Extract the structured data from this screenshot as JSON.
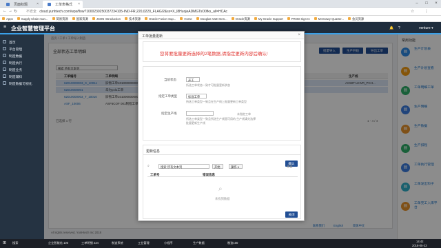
{
  "browser": {
    "tabs": [
      {
        "label": "页面标题"
      },
      {
        "label": "工单表格式"
      }
    ],
    "address": "cloud.yunhtech.com/wps/flow?1000230250037234105-IND-FR,220,0220_FLAG/2&ss=X_l8HuojeADMGTsO0fks_all=HCAc",
    "insecure_label": "不安全",
    "bookmarks": [
      "Apps",
      "Supply Chain man...",
      "简易资源",
      "国家资源",
      "JSON Introduction",
      "技术资源",
      "Oracle Fusion Sup...",
      "Home",
      "Douglas VaEt Gen...",
      "Oracle资源",
      "My Oracle Support",
      "PROD Sign In",
      "McGrawy Quarter...",
      "会员资源"
    ]
  },
  "app": {
    "title": "企业智慧管理平台",
    "user": "venture ▾"
  },
  "sidebar": {
    "items": [
      {
        "label": "首页"
      },
      {
        "label": "平台管理"
      },
      {
        "label": "制造数据"
      },
      {
        "label": "制造执行"
      },
      {
        "label": "制造业务"
      },
      {
        "label": "制造辅料"
      },
      {
        "label": "制造数据可视化"
      }
    ]
  },
  "main": {
    "breadcrumb": "首页 / 工单 / 工单导入制造",
    "page_title": "全部状态工单明细",
    "search_placeholder": "搜索 所有文本列",
    "buttons": [
      "批量导入",
      "生产开始",
      "导出工单"
    ],
    "table": {
      "headers": [
        "",
        "工单编号",
        "工单明细",
        "生产线"
      ],
      "rows": [
        {
          "id": "62010000003_C_10011",
          "desc": "旧物工单1010000000000"
        },
        {
          "id": "62010000001",
          "desc": "华为yolo工单"
        },
        {
          "id": "62010000003_T_10010",
          "desc": "旧物工单1010000000000"
        },
        {
          "id": "ASF_10006",
          "desc": "ASF6COF 001制程工单"
        }
      ],
      "footer": "已选择 1 行",
      "pagination": "1 - 4 / 4",
      "trailing_text": "AC50T-UHVR_PCH..."
    },
    "footer": {
      "copyright": "All rights reserved, YunHtech Inc 2018",
      "links": [
        "联系我们",
        "English",
        "简体中文"
      ]
    }
  },
  "right_panel": {
    "title": "常用功能",
    "items": [
      {
        "label": "生产计划表",
        "color": "#2f8be6"
      },
      {
        "label": "生产计划查看",
        "color": "#f39c12"
      },
      {
        "label": "工单明细工单",
        "color": "#2fb068"
      },
      {
        "label": "生产明细",
        "color": "#3b7de0"
      },
      {
        "label": "生产数据",
        "color": "#e8922a"
      },
      {
        "label": "生产排程",
        "color": "#2fb068"
      },
      {
        "label": "工单执行管理",
        "color": "#3b7de0"
      },
      {
        "label": "工单发出料子",
        "color": "#2fb0c8"
      },
      {
        "label": "工单完工入库平台",
        "color": "#e8922a"
      }
    ]
  },
  "modal": {
    "title": "工单批量更新",
    "warning": "您将要批量更新选择的2笔数据,请指定更新内容后确认!",
    "fields": [
      {
        "label": "当前状态",
        "value": "开工",
        "help": "所选工单状态一致才可批量更新状态"
      },
      {
        "label": "指定工单类型",
        "value": "标准工单",
        "help": "所选工单类型一致且在生产线上批量更新工单类型"
      },
      {
        "label": "指定生产线",
        "value": "",
        "help": "所选工单类型一致且所选生产线是可用的,生产线请先选择",
        "note": "未指定工单",
        "extra": "批量更新生产线"
      }
    ],
    "confirm_label": "确认",
    "results": {
      "title": "更新信息",
      "search_placeholder": "搜索 所有文本列",
      "go_label": "开始",
      "actions_label": "操作 ▾",
      "reset_label": "重置",
      "headers": [
        "工单号",
        "错误信息"
      ],
      "empty": "未找到数据"
    },
    "close_label": "关闭"
  },
  "taskbar": {
    "items": [
      "搜索",
      "企业智能化 100",
      "工单明细 234",
      "制造系统",
      "工业管理",
      "小程序",
      "生产数据",
      "制造100"
    ],
    "time": "14:42",
    "date": "2018-05-23"
  }
}
